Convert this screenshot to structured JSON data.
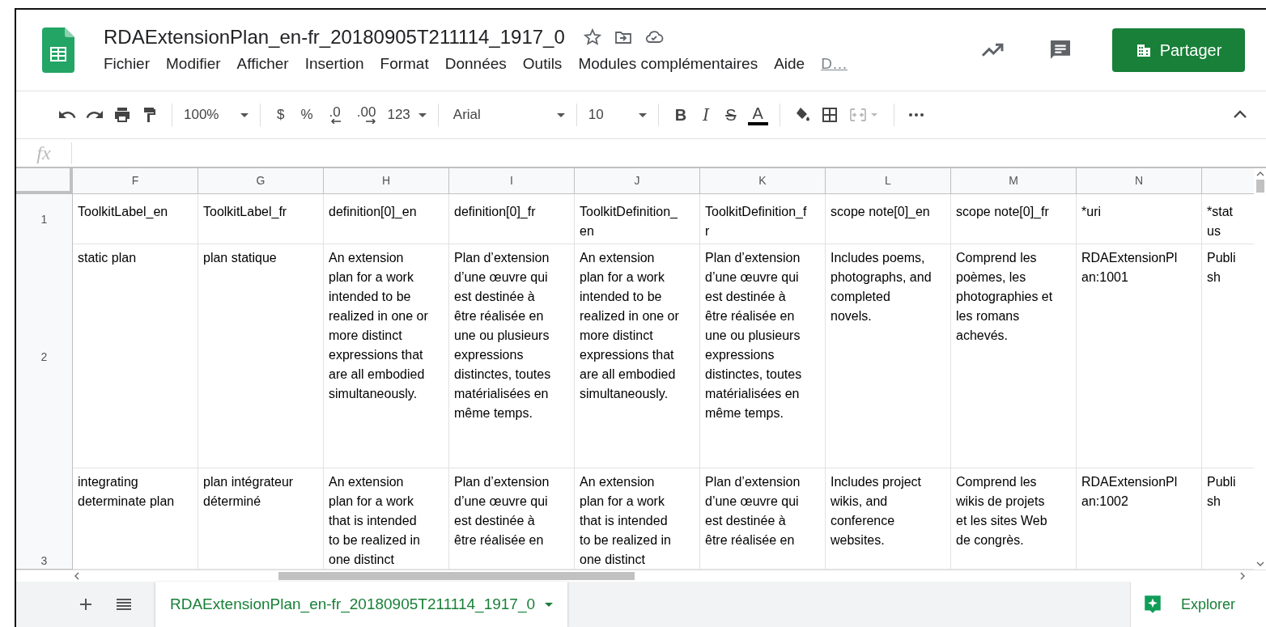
{
  "document": {
    "title": "RDAExtensionPlan_en-fr_20180905T211114_1917_0",
    "menu": [
      "Fichier",
      "Modifier",
      "Afficher",
      "Insertion",
      "Format",
      "Données",
      "Outils",
      "Modules complémentaires",
      "Aide"
    ],
    "last_edit_link": "D…"
  },
  "share_button": {
    "label": "Partager"
  },
  "toolbar": {
    "zoom": "100%",
    "currency": "$",
    "percent": "%",
    "decrease_decimals": ".0",
    "increase_decimals": ".00",
    "number_format": "123",
    "font": "Arial",
    "font_size": "10",
    "bold": "B",
    "italic": "I",
    "strikethrough": "S",
    "text_color": "A"
  },
  "formula_bar": {
    "label": "fx"
  },
  "grid": {
    "column_letters": [
      "F",
      "G",
      "H",
      "I",
      "J",
      "K",
      "L",
      "M",
      "N"
    ],
    "rows": [
      {
        "number": "1",
        "cells": [
          "ToolkitLabel_en",
          "ToolkitLabel_fr",
          "definition[0]_en",
          "definition[0]_fr",
          "ToolkitDefinition_en",
          "ToolkitDefinition_fr",
          "scope note[0]_en",
          "scope note[0]_fr",
          "*uri",
          "*status"
        ]
      },
      {
        "number": "2",
        "cells": [
          "static plan",
          "plan statique",
          "An extension plan for a work intended to be realized in one or more distinct expressions that are all embodied simultaneously.",
          "Plan d’extension d’une œuvre qui est destinée à être réalisée en une ou plusieurs expressions distinctes, toutes matérialisées en même temps.",
          "An extension plan for a work intended to be realized in one or more distinct expressions that are all embodied simultaneously.",
          "Plan d’extension d’une œuvre qui est destinée à être réalisée en une ou plusieurs expressions distinctes, toutes matérialisées en même temps.",
          "Includes poems, photographs, and completed novels.",
          "Comprend les poèmes, les photographies et les romans achevés.",
          "RDAExtensionPlan:1001",
          "Publish"
        ]
      },
      {
        "number": "3",
        "cells": [
          "integrating determinate plan",
          "plan intégrateur déterminé",
          "An extension plan for a work that is intended to be realized in one distinct",
          "Plan d’extension d’une œuvre qui est destinée à être réalisée en",
          "An extension plan for a work that is intended to be realized in one distinct",
          "Plan d’extension d’une œuvre qui est destinée à être réalisée en",
          "Includes project wikis, and conference websites.",
          "Comprend les wikis de projets et les sites Web de congrès.",
          "RDAExtensionPlan:1002",
          "Publish"
        ]
      }
    ]
  },
  "sheet_tabs": [
    {
      "label": "RDAExtensionPlan_en-fr_20180905T211114_1917_0",
      "selected": true
    }
  ],
  "explore_button": {
    "label": "Explorer"
  }
}
